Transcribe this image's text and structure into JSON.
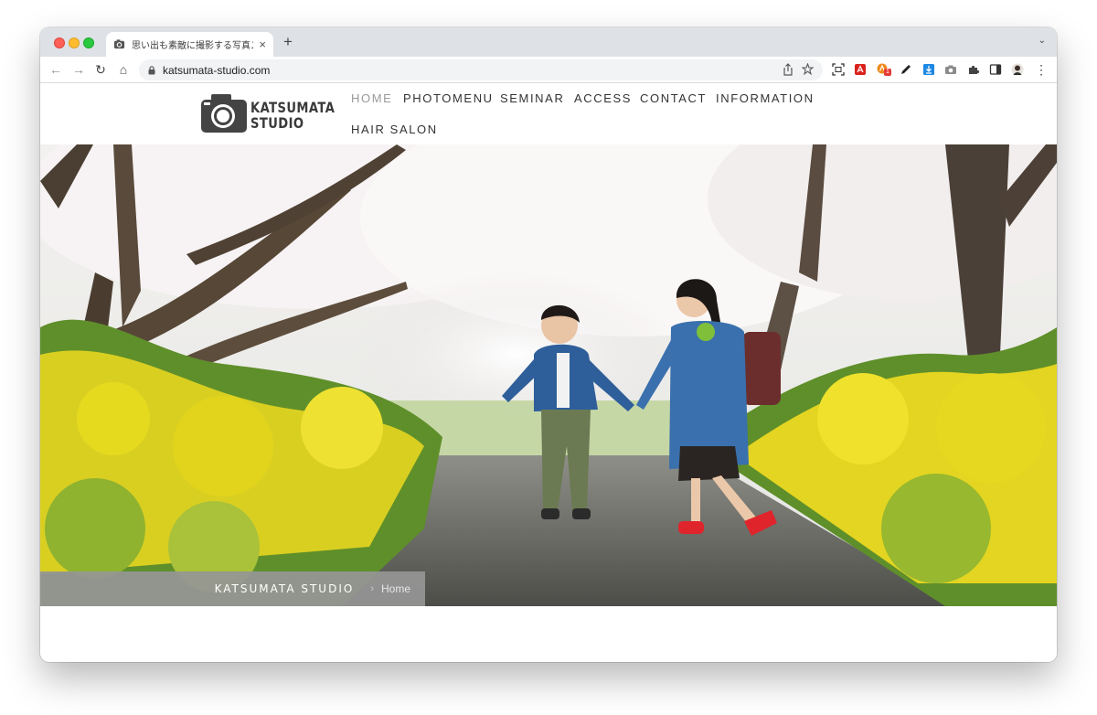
{
  "browser": {
    "tab_title": "思い出も素敵に撮影する写真スタジ",
    "tab_close": "×",
    "new_tab": "+",
    "tab_menu": "⌄",
    "url": "katsumata-studio.com",
    "nav_back": "←",
    "nav_forward": "→",
    "nav_reload": "↻",
    "nav_home": "⌂",
    "extension_badge": "1",
    "menu": "⋮"
  },
  "site": {
    "logo_line1": "KATSUMATA",
    "logo_line2": "STUDIO",
    "nav": [
      {
        "label": "HOME",
        "active": true
      },
      {
        "label": "PHOTOMENU",
        "active": false
      },
      {
        "label": "SEMINAR",
        "active": false
      },
      {
        "label": "ACCESS",
        "active": false
      },
      {
        "label": "CONTACT",
        "active": false
      },
      {
        "label": "INFORMATION",
        "active": false
      },
      {
        "label": "HAIR SALON",
        "active": false
      }
    ],
    "breadcrumb": {
      "site": "KATSUMATA STUDIO",
      "separator": "›",
      "current": "Home"
    }
  },
  "colors": {
    "accent_active_nav": "#9a9a9a",
    "breadcrumb_bg": "#969696"
  }
}
